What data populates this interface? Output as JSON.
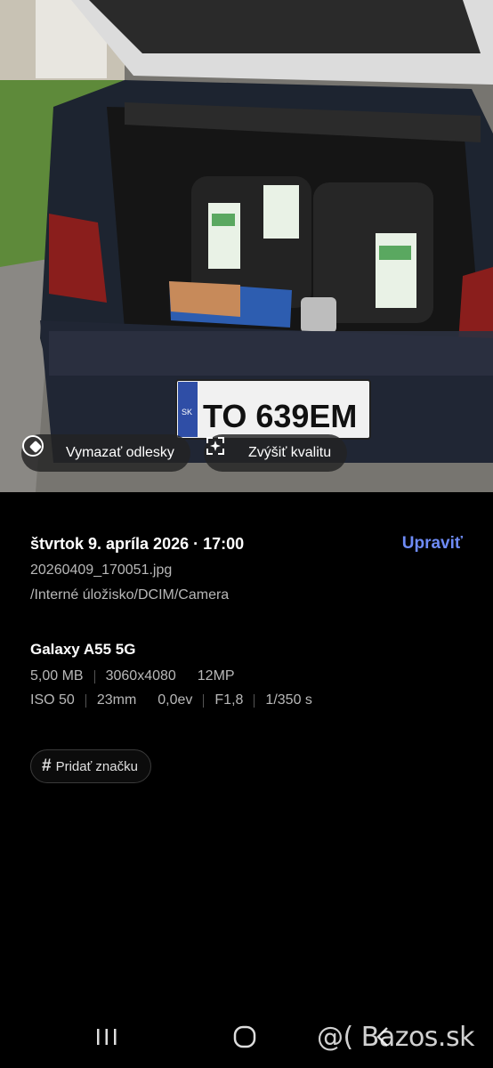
{
  "photo_actions": {
    "erase_reflections": "Vymazať odlesky",
    "enhance_quality": "Zvýšiť kvalitu"
  },
  "plate_text": "TO 639EM",
  "details": {
    "datetime": "štvrtok 9. apríla 2026 · 17:00",
    "edit_label": "Upraviť",
    "filename": "20260409_170051.jpg",
    "path": "/Interné úložisko/DCIM/Camera",
    "device": "Galaxy A55 5G",
    "size": "5,00 MB",
    "resolution": "3060x4080",
    "megapixels": "12MP",
    "iso": "ISO 50",
    "focal_length": "23mm",
    "exposure": "0,0ev",
    "aperture": "F1,8",
    "shutter": "1/350 s",
    "add_tag": "Pridať značku"
  },
  "watermark": "@( Bazos.sk",
  "colors": {
    "accent": "#6e8bf6",
    "background": "#000000"
  }
}
